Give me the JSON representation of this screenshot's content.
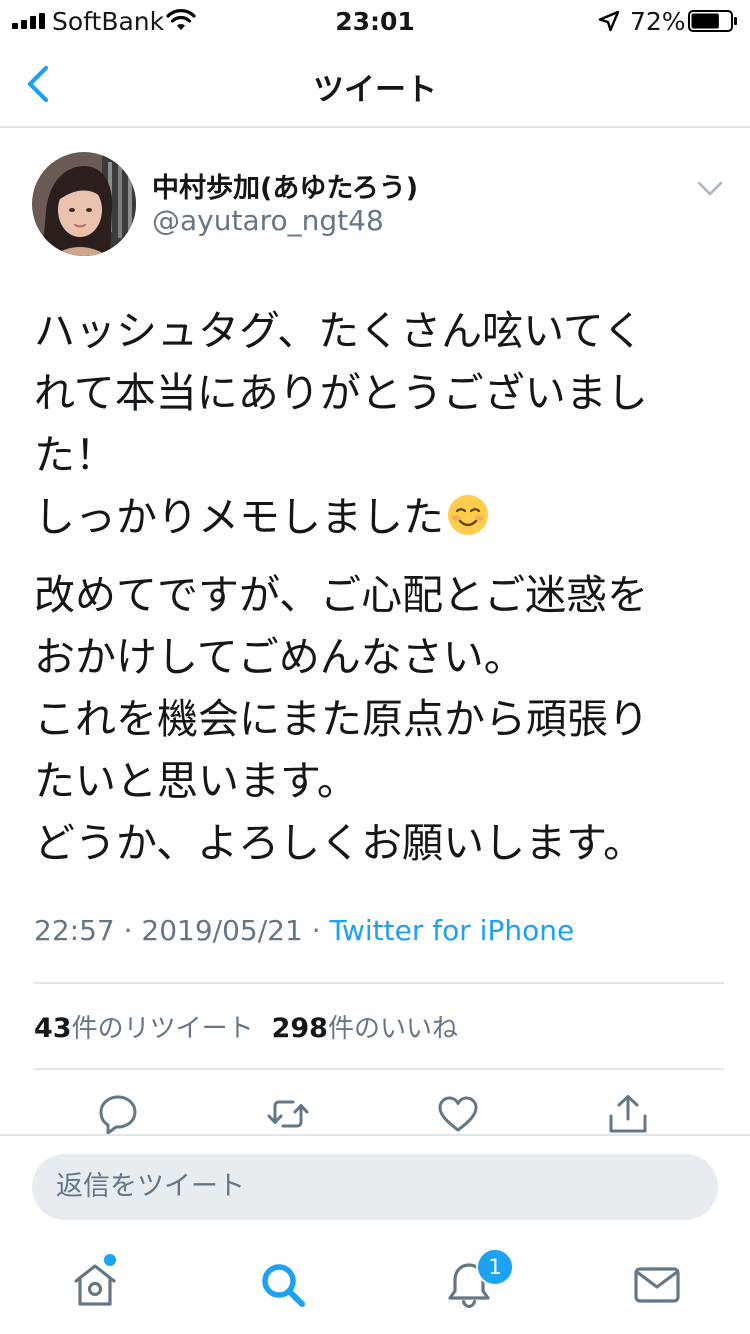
{
  "status_bar": {
    "carrier": "SoftBank",
    "time": "23:01",
    "battery_percent": "72%",
    "battery_level": 0.72
  },
  "nav": {
    "title": "ツイート",
    "back_icon": "chevron-left-icon"
  },
  "tweet": {
    "display_name": "中村歩加(あゆたろう)",
    "handle": "@ayutaro_ngt48",
    "paragraphs": [
      "ハッシュタグ、たくさん呟いてく\nれて本当にありがとうございまし\nた！\nしっかりメモしました",
      "改めてですが、ご心配とご迷惑を\nおかけしてごめんなさい。\nこれを機会にまた原点から頑張り\nたいと思います。\nどうか、よろしくお願いします。"
    ],
    "emoji": "smiling-face-emoji",
    "time": "22:57",
    "date": "2019/05/21",
    "separator": "·",
    "client": "Twitter for iPhone",
    "stats": {
      "retweets": "43",
      "retweets_label": "件のリツイート",
      "likes": "298",
      "likes_label": "件のいいね"
    }
  },
  "reply": {
    "placeholder": "返信をツイート"
  },
  "tabbar": {
    "notification_count": "1"
  },
  "colors": {
    "accent": "#1da1f2",
    "text": "#14171a",
    "muted": "#657786",
    "divider": "#e1e8ed",
    "input_bg": "#e6ecf0"
  }
}
